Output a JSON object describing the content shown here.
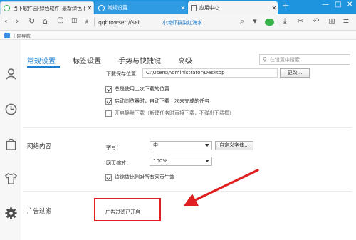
{
  "tabs": [
    {
      "title": "当下软件园-绿色软件_最新绿色下"
    },
    {
      "title": "常规设置"
    },
    {
      "title": "应用中心"
    }
  ],
  "toolbar": {
    "address": "qqbrowser://set",
    "hot_search": "小龙虾群染红海水"
  },
  "bookmarks": {
    "items": [
      {
        "label": "上网导航"
      }
    ]
  },
  "settings_tabs": [
    {
      "label": "常规设置",
      "active": true
    },
    {
      "label": "标签设置",
      "active": false
    },
    {
      "label": "手势与快捷键",
      "active": false
    },
    {
      "label": "高级",
      "active": false
    }
  ],
  "search": {
    "placeholder": "在设置中搜索"
  },
  "download": {
    "label": "下载保存位置",
    "path": "C:\\Users\\Administrator\\Desktop",
    "change_button": "更改...",
    "options": [
      {
        "label": "总是使用上次下载的位置",
        "checked": true
      },
      {
        "label": "启动浏览器时，自动下载上次未完成的任务",
        "checked": true
      },
      {
        "label": "开启静默下载（新建任务时直接下载，不弹出下载框）",
        "checked": false
      }
    ]
  },
  "web_content": {
    "section_title": "网络内容",
    "font_size_label": "字号：",
    "font_size_value": "中",
    "custom_font_button": "自定义字体...",
    "zoom_label": "网页缩放：",
    "zoom_value": "100%",
    "zoom_option": {
      "label": "该缩放比例对所有网页生效",
      "checked": true
    }
  },
  "ad_filter": {
    "section_title": "广告过滤",
    "status": "广告过滤已开启"
  },
  "colors": {
    "accent": "#1e7fd1",
    "tabbar": "#1e94df",
    "highlight": "#e02020"
  }
}
